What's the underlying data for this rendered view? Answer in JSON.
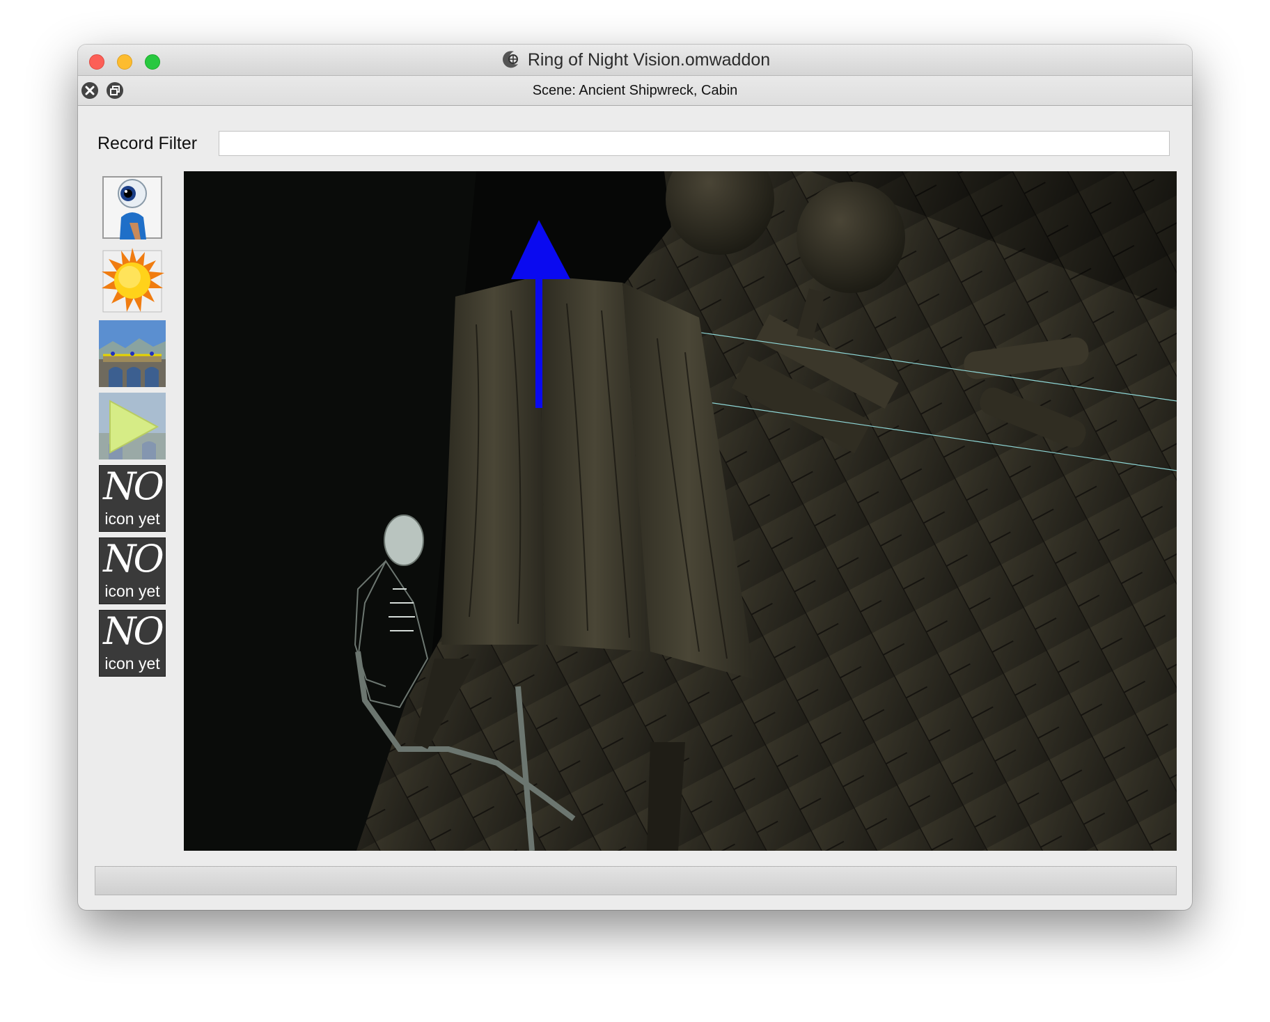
{
  "window": {
    "title": "Ring of Night Vision.omwaddon",
    "app_icon": "openmw-cs-icon",
    "controls": [
      "close-icon",
      "minimize-icon",
      "zoom-icon"
    ]
  },
  "subwindow": {
    "title": "Scene: Ancient Shipwreck, Cabin",
    "buttons": [
      "close-icon",
      "float-icon"
    ]
  },
  "filter": {
    "label": "Record Filter",
    "value": "",
    "placeholder": ""
  },
  "toolbar": {
    "tools": [
      {
        "name": "camera-mode-icon"
      },
      {
        "name": "lighting-mode-icon"
      },
      {
        "name": "scene-mode-icon"
      },
      {
        "name": "run-game-icon"
      },
      {
        "name": "no-icon-placeholder",
        "line1": "NO",
        "line2": "icon yet"
      },
      {
        "name": "no-icon-placeholder",
        "line1": "NO",
        "line2": "icon yet"
      },
      {
        "name": "no-icon-placeholder",
        "line1": "NO",
        "line2": "icon yet"
      }
    ]
  },
  "colors": {
    "window_bg": "#ececec",
    "gizmo_blue": "#0a0af0",
    "guide_line": "#8fd8d8",
    "wood": "#3a3628"
  }
}
